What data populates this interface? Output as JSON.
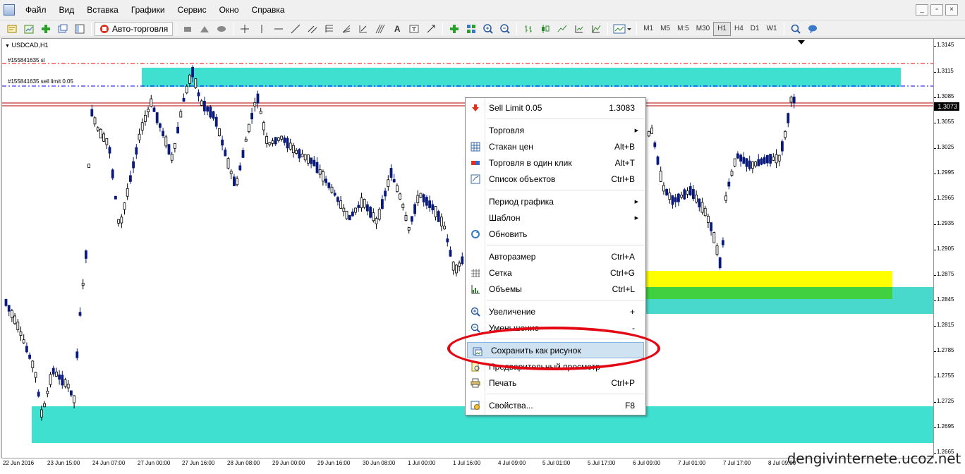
{
  "menubar": {
    "items": [
      "Файл",
      "Вид",
      "Вставка",
      "Графики",
      "Сервис",
      "Окно",
      "Справка"
    ],
    "win_minimize": "_",
    "win_restore": "▫",
    "win_close": "×"
  },
  "toolbar": {
    "autotrade_label": "Авто-торговля",
    "timeframes": [
      "M1",
      "M5",
      "M15",
      "M30",
      "H1",
      "H4",
      "D1",
      "W1"
    ],
    "timeframes_display": [
      "M1",
      "M5",
      "M:5",
      "M30",
      "H1",
      "H4",
      "D1",
      "W1"
    ],
    "active_timeframe": "H1"
  },
  "chart": {
    "symbol": "USDCAD,H1",
    "order_sl_label": "#155841635 sl",
    "order_limit_label": "#155841635 sell limit 0.05",
    "current_price": "1.3073",
    "price_ticks": [
      "1.3145",
      "1.3115",
      "1.3085",
      "1.3055",
      "1.3025",
      "1.2995",
      "1.2965",
      "1.2935",
      "1.2905",
      "1.2875",
      "1.2845",
      "1.2815",
      "1.2785",
      "1.2755",
      "1.2725",
      "1.2695",
      "1.2665"
    ],
    "time_ticks": [
      "22 Jun 2016",
      "23 Jun 15:00",
      "24 Jun 07:00",
      "27 Jun 00:00",
      "27 Jun 16:00",
      "28 Jun 08:00",
      "29 Jun 00:00",
      "29 Jun 16:00",
      "30 Jun 08:00",
      "1 Jul 00:00",
      "1 Jul 16:00",
      "4 Jul 09:00",
      "5 Jul 01:00",
      "5 Jul 17:00",
      "6 Jul 09:00",
      "7 Jul 01:00",
      "7 Jul 17:00",
      "8 Jul 09:00"
    ],
    "colors": {
      "zone_cyan": "#40e0d0",
      "zone_yellow": "#ffff00",
      "zone_green": "#40d040",
      "sl_line": "#ff0000",
      "limit_line": "#0000ff",
      "bull_candle": "#0a1a7a",
      "bear_candle": "#000000"
    }
  },
  "context_menu": {
    "sell_limit_label": "Sell Limit 0.05",
    "sell_limit_price": "1.3083",
    "trading": "Торговля",
    "depth": "Стакан цен",
    "depth_shortcut": "Alt+B",
    "one_click": "Торговля в один клик",
    "one_click_shortcut": "Alt+T",
    "objects": "Список объектов",
    "objects_shortcut": "Ctrl+B",
    "period": "Период графика",
    "template": "Шаблон",
    "refresh": "Обновить",
    "autoscale": "Авторазмер",
    "autoscale_shortcut": "Ctrl+A",
    "grid": "Сетка",
    "grid_shortcut": "Ctrl+G",
    "volumes": "Объемы",
    "volumes_shortcut": "Ctrl+L",
    "zoom_in": "Увеличение",
    "zoom_in_shortcut": "+",
    "zoom_out": "Уменьшение",
    "zoom_out_shortcut": "-",
    "save_picture": "Сохранить как рисунок",
    "preview": "Предварительный просмотр",
    "print": "Печать",
    "print_shortcut": "Ctrl+P",
    "properties": "Свойства...",
    "properties_shortcut": "F8"
  },
  "watermark": "dengivinternete.ucoz.net"
}
